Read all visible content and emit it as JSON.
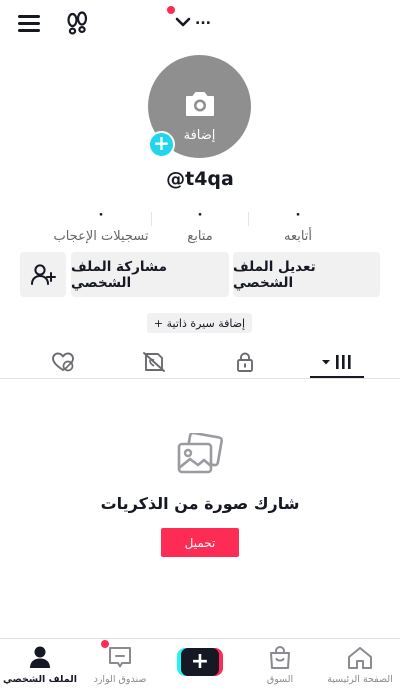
{
  "header": {
    "more_glyph": "..."
  },
  "profile": {
    "avatar_add_label": "إضافة",
    "username": "@t4qa",
    "bio_button": "+ إضافة سيرة ذاتية"
  },
  "stats": [
    {
      "value": "٠",
      "label": "أتابعه"
    },
    {
      "value": "٠",
      "label": "متابع"
    },
    {
      "value": "٠",
      "label": "تسجيلات الإعجاب"
    }
  ],
  "actions": {
    "edit_profile": "تعديل الملف الشخصي",
    "share_profile": "مشاركة الملف الشخصي"
  },
  "tabs": [
    {
      "name": "videos",
      "icon": "grid-icon",
      "active": true
    },
    {
      "name": "private",
      "icon": "lock-icon",
      "active": false
    },
    {
      "name": "favorites",
      "icon": "hidden-like-icon",
      "active": false
    },
    {
      "name": "liked",
      "icon": "heart-hidden-icon",
      "active": false
    }
  ],
  "empty_state": {
    "title": "شارك صورة من الذكريات",
    "button": "تحميل"
  },
  "bottom_nav": [
    {
      "label": "الصفحة الرئيسية",
      "icon": "home-icon"
    },
    {
      "label": "السوق",
      "icon": "shop-bag-icon"
    },
    {
      "label": "",
      "icon": "create-plus-icon"
    },
    {
      "label": "صندوق الوارد",
      "icon": "inbox-icon"
    },
    {
      "label": "الملف الشخصي",
      "icon": "profile-icon",
      "active": true
    }
  ],
  "colors": {
    "accent": "#fe2c55",
    "cyan": "#25f4ee",
    "avatar_plus": "#20d5ec",
    "text": "#161823"
  }
}
